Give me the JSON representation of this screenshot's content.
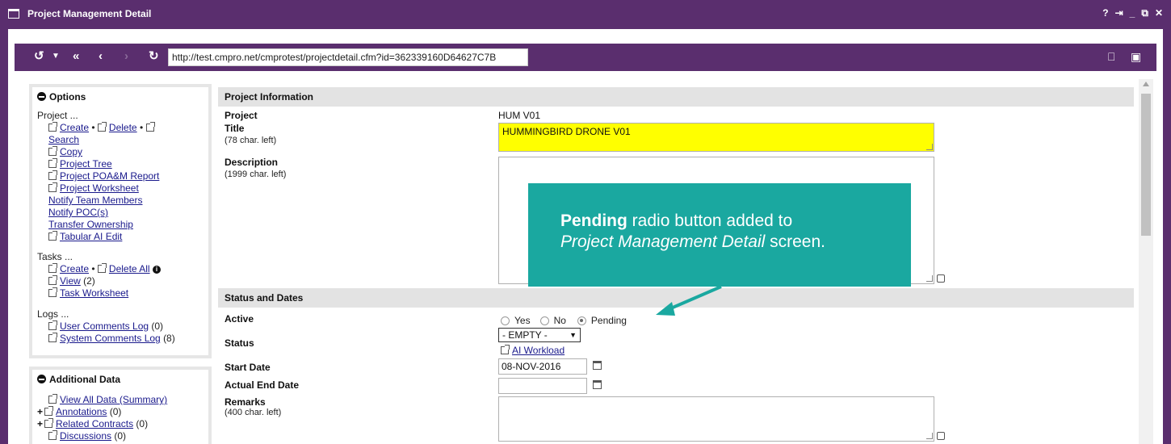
{
  "window": {
    "title": "Project Management Detail",
    "controls": [
      "?",
      "⇥",
      "_",
      "⧉",
      "✕"
    ]
  },
  "toolbar": {
    "url": "http://test.cmpro.net/cmprotest/projectdetail.cfm?id=362339160D64627C7B",
    "icons": [
      "history-icon",
      "dropdown-icon",
      "first-icon",
      "back-icon",
      "forward-icon",
      "refresh-icon",
      "bookmark-icon",
      "save-icon"
    ]
  },
  "options_panel": {
    "title": "Options",
    "project_label": "Project ...",
    "create": "Create",
    "delete": "Delete",
    "search": "Search",
    "copy": "Copy",
    "project_tree": "Project Tree",
    "poam_report": "Project POA&M Report",
    "worksheet": "Project Worksheet",
    "notify_team": "Notify Team Members",
    "notify_poc": "Notify POC(s)",
    "transfer": "Transfer Ownership",
    "tabular": "Tabular AI Edit",
    "tasks_label": "Tasks ...",
    "task_create": "Create",
    "task_delete_all": "Delete All",
    "task_view": "View",
    "task_view_count": "(2)",
    "task_worksheet": "Task Worksheet",
    "logs_label": "Logs ...",
    "user_comments": "User Comments Log",
    "user_comments_count": "(0)",
    "system_comments": "System Comments Log",
    "system_comments_count": "(8)"
  },
  "additional_panel": {
    "title": "Additional Data",
    "view_all": "View All Data (Summary)",
    "annotations": "Annotations",
    "annotations_count": "(0)",
    "related_contracts": "Related Contracts",
    "related_contracts_count": "(0)",
    "discussions": "Discussions",
    "discussions_count": "(0)"
  },
  "project_info": {
    "section": "Project Information",
    "project_label": "Project",
    "project_value": "HUM V01",
    "title_label": "Title",
    "title_hint": "(78 char. left)",
    "title_value": "HUMMINGBIRD DRONE V01",
    "description_label": "Description",
    "description_hint": "(1999 char. left)",
    "description_value": ""
  },
  "status_dates": {
    "section": "Status and Dates",
    "active_label": "Active",
    "radio_yes": "Yes",
    "radio_no": "No",
    "radio_pending": "Pending",
    "selected": "Pending",
    "status_label": "Status",
    "status_value": "- EMPTY -",
    "ai_workload": "AI Workload",
    "start_date_label": "Start Date",
    "start_date_value": "08-NOV-2016",
    "actual_end_label": "Actual End Date",
    "actual_end_value": "",
    "remarks_label": "Remarks",
    "remarks_hint": "(400 char. left)",
    "remarks_value": ""
  },
  "callout": {
    "bold": "Pending",
    "text1": " radio button added to",
    "italic": "Project Management Detail",
    "text2": " screen."
  },
  "colors": {
    "frame": "#5a2e6e",
    "callout": "#1aa8a0",
    "title_field": "#ffff00"
  }
}
